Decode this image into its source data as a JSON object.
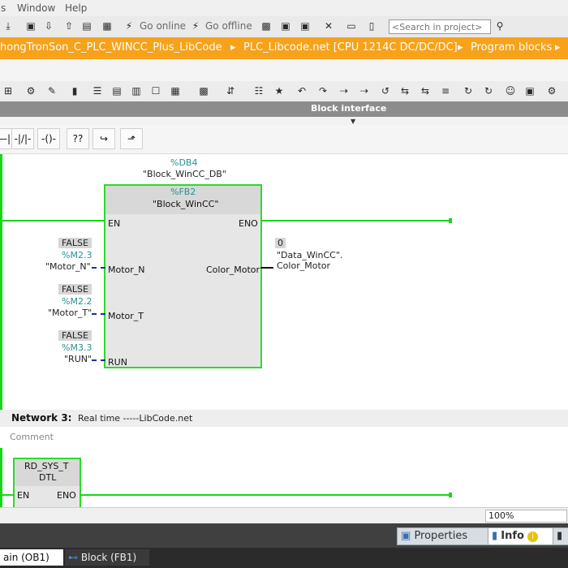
{
  "menu": {
    "items": [
      "s",
      "Window",
      "Help"
    ]
  },
  "toolbar": {
    "go_online": "Go online",
    "go_offline": "Go offline",
    "search_placeholder": "<Search in project>"
  },
  "breadcrumb": {
    "items": [
      "hongTronSon_C_PLC_WINCC_Plus_LibCode",
      "PLC_Libcode.net [CPU 1214C DC/DC/DC]",
      "Program blocks"
    ],
    "separator": "▸",
    "more": "▸"
  },
  "block_interface": {
    "label": "Block interface"
  },
  "network2": {
    "instance_db_addr": "%DB4",
    "instance_db_name": "\"Block_WinCC_DB\"",
    "fb_addr": "%FB2",
    "fb_name": "\"Block_WinCC\"",
    "pins": {
      "en": "EN",
      "eno": "ENO",
      "motor_n": "Motor_N",
      "motor_t": "Motor_T",
      "run": "RUN",
      "color_motor": "Color_Motor"
    },
    "inputs": [
      {
        "value": "FALSE",
        "addr": "%M2.3",
        "tag": "\"Motor_N\""
      },
      {
        "value": "FALSE",
        "addr": "%M2.2",
        "tag": "\"Motor_T\""
      },
      {
        "value": "FALSE",
        "addr": "%M3.3",
        "tag": "\"RUN\""
      }
    ],
    "output": {
      "value": "0",
      "tag_line1": "\"Data_WinCC\".",
      "tag_line2": "Color_Motor"
    }
  },
  "network3": {
    "title": "Network 3:",
    "description": "Real time -----LibCode.net",
    "comment": "Comment",
    "block_name_line1": "RD_SYS_T",
    "block_name_line2": "DTL",
    "en": "EN",
    "eno": "ENO"
  },
  "zoom": "100%",
  "inspector": {
    "properties": "Properties",
    "info": "Info",
    "info_badge": "i"
  },
  "taskbar": {
    "main": "ain (OB1)",
    "block": "Block (FB1)"
  },
  "colors": {
    "breadcrumb": "#f7a21a",
    "rung": "#19d619",
    "fb_border": "#2bdb2b",
    "addr": "#2c8f8f"
  }
}
